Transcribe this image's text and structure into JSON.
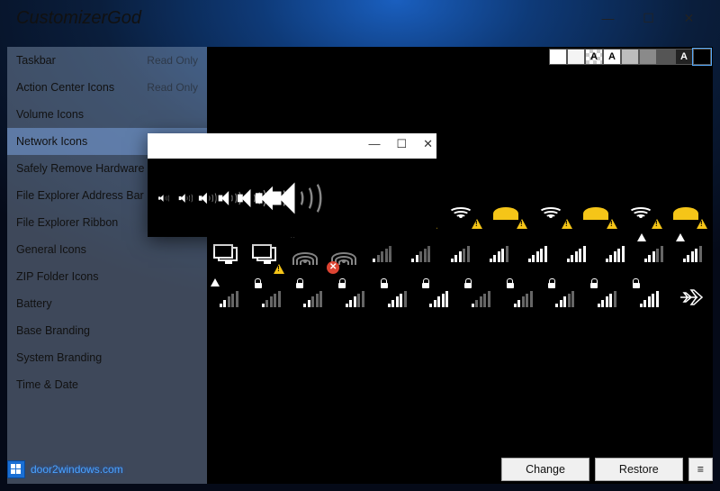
{
  "app": {
    "title": "CustomizerGod"
  },
  "window_controls": {
    "min": "—",
    "max": "☐",
    "close": "✕"
  },
  "sidebar": {
    "items": [
      {
        "label": "Taskbar",
        "badge": "Read Only"
      },
      {
        "label": "Action Center Icons",
        "badge": "Read Only"
      },
      {
        "label": "Volume Icons",
        "badge": ""
      },
      {
        "label": "Network Icons",
        "badge": ""
      },
      {
        "label": "Safely Remove Hardware",
        "badge": ""
      },
      {
        "label": "File Explorer Address Bar",
        "badge": ""
      },
      {
        "label": "File Explorer Ribbon",
        "badge": ""
      },
      {
        "label": "General Icons",
        "badge": ""
      },
      {
        "label": "ZIP Folder Icons",
        "badge": ""
      },
      {
        "label": "Battery",
        "badge": ""
      },
      {
        "label": "Base Branding",
        "badge": ""
      },
      {
        "label": "System Branding",
        "badge": ""
      },
      {
        "label": "Time & Date",
        "badge": ""
      }
    ],
    "selected_index": 3
  },
  "swatches": [
    {
      "bg": "#ffffff",
      "fg": "#000000",
      "label": ""
    },
    {
      "bg": "#f4f4f4",
      "fg": "#000000",
      "label": ""
    },
    {
      "bg": "#ffffff",
      "fg": "#000000",
      "label": "A",
      "checker": true
    },
    {
      "bg": "#ffffff",
      "fg": "#000000",
      "label": "A"
    },
    {
      "bg": "#bdbdbd",
      "fg": "#000000",
      "label": ""
    },
    {
      "bg": "#8a8a8a",
      "fg": "#000000",
      "label": ""
    },
    {
      "bg": "#555555",
      "fg": "#ffffff",
      "label": ""
    },
    {
      "bg": "#222222",
      "fg": "#ffffff",
      "label": "A"
    },
    {
      "bg": "#000000",
      "fg": "#ffffff",
      "label": "",
      "selected": true
    }
  ],
  "popup": {
    "controls": {
      "min": "—",
      "max": "☐",
      "close": "✕"
    },
    "icons": [
      "volume-xs",
      "volume-sm",
      "volume-md",
      "volume-lg",
      "volume-xl",
      "volume-2xl",
      "volume-3xl"
    ]
  },
  "grid": {
    "row1_right": [
      "wifi-white-warn",
      "wifi-yellow-warn",
      "wifi-white-warn",
      "wifi-yellow-warn",
      "wifi-white-warn",
      "wifi-yellow-warn",
      "wifi-white-warn",
      "wifi-yellow-warn"
    ],
    "row2": [
      "monitors-dual",
      "monitors-dual-warn",
      "wifi-star",
      "wifi-error",
      "bars-1",
      "bars-2",
      "bars-3",
      "bars-4",
      "bars-5",
      "bars-5b",
      "bars-5c",
      "bars-tri-1",
      "bars-tri-2"
    ],
    "row3": [
      "bars-tri-3",
      "bars-lock-1",
      "bars-lock-2",
      "bars-lock-3",
      "bars-lock-4",
      "bars-lock-5",
      "bars-lock-6",
      "bars-lock-7",
      "bars-lock-8",
      "bars-lock-9",
      "bars-lock-10",
      "airplane-mode"
    ]
  },
  "footer": {
    "link_text": "door2windows.com",
    "change_label": "Change",
    "restore_label": "Restore",
    "menu_label": "≡"
  }
}
